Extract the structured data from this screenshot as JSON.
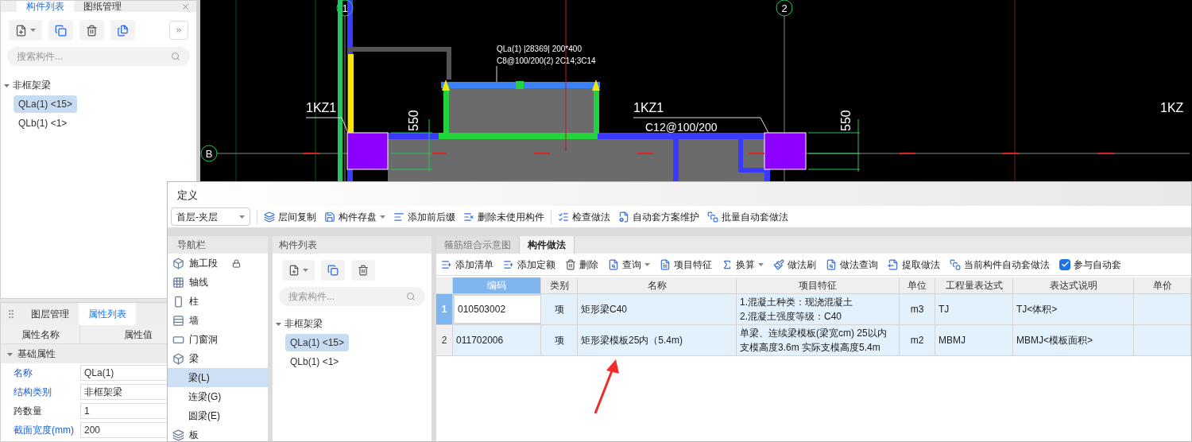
{
  "left_panel": {
    "tabs": [
      {
        "label": "构件列表",
        "selected": true
      },
      {
        "label": "图纸管理",
        "selected": false
      }
    ],
    "search": {
      "placeholder": "搜索构件..."
    },
    "tree": [
      {
        "label": "非框架梁",
        "expanded": true,
        "children": [
          {
            "label": "QLa(1) <15>",
            "selected": true
          },
          {
            "label": "QLb(1) <1>",
            "selected": false
          }
        ]
      }
    ]
  },
  "property_panel": {
    "tabs": [
      {
        "label": "图层管理",
        "selected": false
      },
      {
        "label": "属性列表",
        "selected": true
      }
    ],
    "columns": [
      "属性名称",
      "属性值"
    ],
    "groups": [
      {
        "label": "基础属性",
        "expanded": true,
        "rows": [
          {
            "name": "名称",
            "value": "QLa(1)",
            "public": true
          },
          {
            "name": "结构类别",
            "value": "非框架梁",
            "public": true
          },
          {
            "name": "跨数量",
            "value": "1",
            "public": false
          },
          {
            "name": "截面宽度(mm)",
            "value": "200",
            "public": true
          }
        ]
      }
    ]
  },
  "cad": {
    "axes": [
      "1",
      "2",
      "B"
    ],
    "labels": [
      "QLa(1) |28369| 200*400",
      "C8@100/200(2) 2C14;3C14",
      "1KZ1",
      "1KZ1",
      "C12@100/200",
      "550",
      "550",
      "1KZ"
    ]
  },
  "dialog": {
    "title": "定义",
    "floor_select": "首层-夹层",
    "toolbar_groups": [
      [
        {
          "label": "层间复制",
          "dropdown": false
        },
        {
          "label": "构件存盘",
          "dropdown": true
        },
        {
          "label": "添加前后缀",
          "dropdown": false
        },
        {
          "label": "删除未使用构件",
          "dropdown": false
        }
      ],
      [
        {
          "label": "检查做法",
          "dropdown": false
        },
        {
          "label": "自动套方案维护",
          "dropdown": false
        },
        {
          "label": "批量自动套做法",
          "dropdown": false
        }
      ]
    ],
    "navigation": {
      "title": "导航栏",
      "items": [
        {
          "label": "施工段",
          "locked": true,
          "selected": false
        },
        {
          "label": "轴线",
          "locked": false,
          "selected": false
        },
        {
          "label": "柱",
          "locked": false,
          "selected": false
        },
        {
          "label": "墙",
          "locked": false,
          "selected": false
        },
        {
          "label": "门窗洞",
          "locked": false,
          "selected": false
        },
        {
          "label": "梁",
          "locked": false,
          "selected": false,
          "children": [
            {
              "label": "梁(L)",
              "selected": true
            },
            {
              "label": "连梁(G)",
              "selected": false
            },
            {
              "label": "圆梁(E)",
              "selected": false
            }
          ]
        },
        {
          "label": "板",
          "locked": false,
          "selected": false
        }
      ]
    },
    "component_list": {
      "title": "构件列表",
      "search": {
        "placeholder": "搜索构件..."
      },
      "tree": [
        {
          "label": "非框架梁",
          "expanded": true,
          "children": [
            {
              "label": "QLa(1) <15>",
              "selected": true
            },
            {
              "label": "QLb(1) <1>",
              "selected": false
            }
          ]
        }
      ]
    },
    "tabs": [
      {
        "label": "箍筋组合示意图",
        "selected": false
      },
      {
        "label": "构件做法",
        "selected": true
      }
    ],
    "method_toolbar": [
      {
        "label": "添加清单",
        "dropdown": false
      },
      {
        "label": "添加定额",
        "dropdown": false
      },
      {
        "label": "删除",
        "dropdown": false
      },
      {
        "label": "查询",
        "dropdown": true
      },
      {
        "label": "项目特征",
        "dropdown": false
      },
      {
        "label": "换算",
        "dropdown": true
      },
      {
        "label": "做法刷",
        "dropdown": false
      },
      {
        "label": "做法查询",
        "dropdown": false
      },
      {
        "label": "提取做法",
        "dropdown": false
      },
      {
        "label": "当前构件自动套做法",
        "dropdown": false
      }
    ],
    "auto_checkbox": {
      "label": "参与自动套",
      "checked": true
    },
    "table": {
      "columns": [
        {
          "label": "编码",
          "selected": true
        },
        {
          "label": "类别",
          "selected": false
        },
        {
          "label": "名称",
          "selected": false
        },
        {
          "label": "项目特征",
          "selected": false
        },
        {
          "label": "单位",
          "selected": false
        },
        {
          "label": "工程量表达式",
          "selected": false
        },
        {
          "label": "表达式说明",
          "selected": false
        },
        {
          "label": "单价",
          "selected": false
        }
      ],
      "rows": [
        {
          "number": "1",
          "selected": true,
          "code": "010503002",
          "type": "项",
          "name": "矩形梁C40",
          "features": [
            "1.混凝土种类：现浇混凝土",
            "2.混凝土强度等级：C40"
          ],
          "unit": "m3",
          "expression": "TJ",
          "description": "TJ<体积>"
        },
        {
          "number": "2",
          "selected": false,
          "code": "011702006",
          "type": "项",
          "name": "矩形梁模板25内（5.4m)",
          "features": [
            "单梁、连续梁模板(梁宽cm) 25以内",
            "支模高度3.6m 实际支模高度5.4m"
          ],
          "unit": "m2",
          "expression": "MBMJ",
          "description": "MBMJ<模板面积>"
        }
      ]
    }
  }
}
